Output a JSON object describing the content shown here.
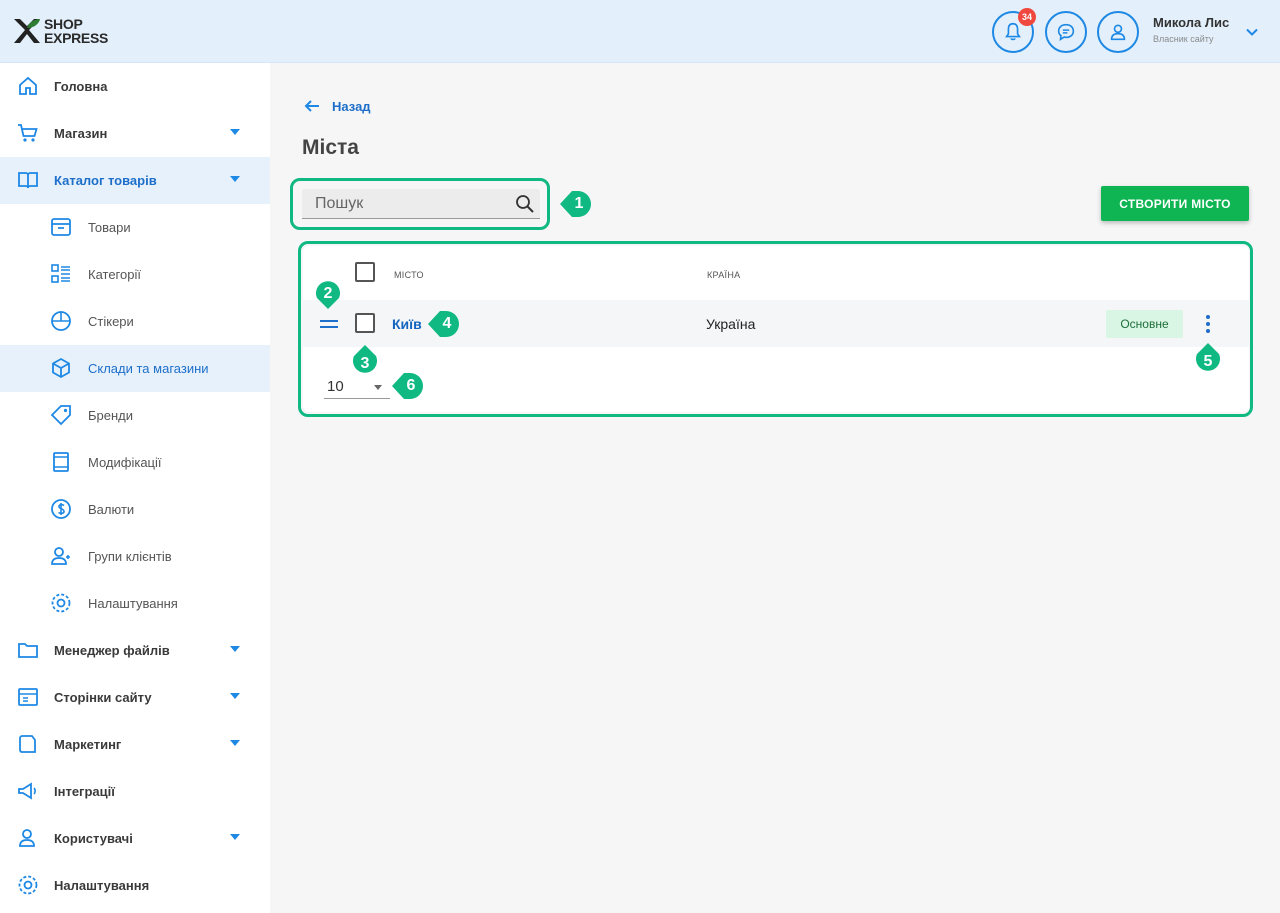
{
  "header": {
    "logo_line1": "SHOP",
    "logo_line2": "EXPRESS",
    "notification_count": "34",
    "user_name": "Микола Лис",
    "user_role": "Власник сайту"
  },
  "sidebar": {
    "items": [
      {
        "label": "Головна"
      },
      {
        "label": "Магазин"
      },
      {
        "label": "Каталог товарів"
      },
      {
        "label": "Товари"
      },
      {
        "label": "Категорії"
      },
      {
        "label": "Стікери"
      },
      {
        "label": "Склади та магазини"
      },
      {
        "label": "Бренди"
      },
      {
        "label": "Модифікації"
      },
      {
        "label": "Валюти"
      },
      {
        "label": "Групи клієнтів"
      },
      {
        "label": "Налаштування"
      },
      {
        "label": "Менеджер файлів"
      },
      {
        "label": "Сторінки сайту"
      },
      {
        "label": "Маркетинг"
      },
      {
        "label": "Інтеграції"
      },
      {
        "label": "Користувачі"
      },
      {
        "label": "Налаштування"
      }
    ]
  },
  "main": {
    "back_label": "Назад",
    "page_title": "Міста",
    "search_placeholder": "Пошук",
    "create_button": "СТВОРИТИ МІСТО",
    "columns": {
      "city": "МІСТО",
      "country": "КРАЇНА"
    },
    "rows": [
      {
        "city": "Київ",
        "country": "Україна",
        "status": "Основне"
      }
    ],
    "page_size": "10"
  },
  "markers": [
    "1",
    "2",
    "3",
    "4",
    "5",
    "6"
  ],
  "colors": {
    "accent": "#1e88e5",
    "highlight": "#10b981",
    "create": "#0fb552"
  }
}
